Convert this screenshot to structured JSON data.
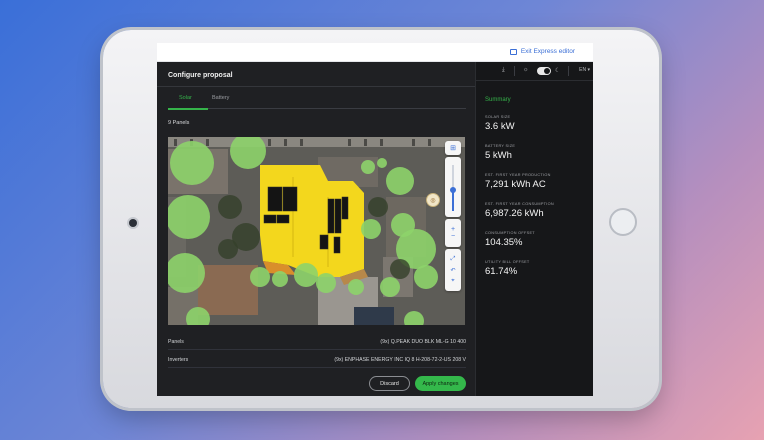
{
  "topbar": {
    "exit_label": "Exit Express editor"
  },
  "proposal": {
    "title": "Configure proposal",
    "tabs": [
      {
        "label": "Solar",
        "active": true
      },
      {
        "label": "Battery",
        "active": false
      }
    ],
    "panels_count": "9 Panels",
    "rows": [
      {
        "label": "Panels",
        "value": "(9x) Q.PEAK DUO BLK ML-G 10 400"
      },
      {
        "label": "Inverters",
        "value": "(9x) ENPHASE ENERGY INC IQ 8 H-208-72-2-US 208 V"
      }
    ],
    "discard_label": "Discard",
    "apply_label": "Apply changes"
  },
  "toolbar": {
    "language": "EN"
  },
  "summary": {
    "title": "Summary",
    "metrics": [
      {
        "label": "SOLAR SIZE",
        "value": "3.6 kW"
      },
      {
        "label": "BATTERY SIZE",
        "value": "5 kWh"
      },
      {
        "label": "EST. FIRST YEAR PRODUCTION",
        "value": "7,291 kWh AC"
      },
      {
        "label": "EST. FIRST YEAR CONSUMPTION",
        "value": "6,987.26 kWh"
      },
      {
        "label": "CONSUMPTION OFFSET",
        "value": "104.35%"
      },
      {
        "label": "UTILITY BILL OFFSET",
        "value": "61.74%"
      }
    ]
  },
  "icons": {
    "download": "download-icon",
    "sun": "sun-icon",
    "moon": "moon-icon",
    "zoom_in": "plus-icon",
    "zoom_out": "minus-icon"
  },
  "colors": {
    "accent": "#35b34a",
    "link": "#3b6fd6",
    "roof": "#f2d61a",
    "tree": "#8fd36a"
  }
}
